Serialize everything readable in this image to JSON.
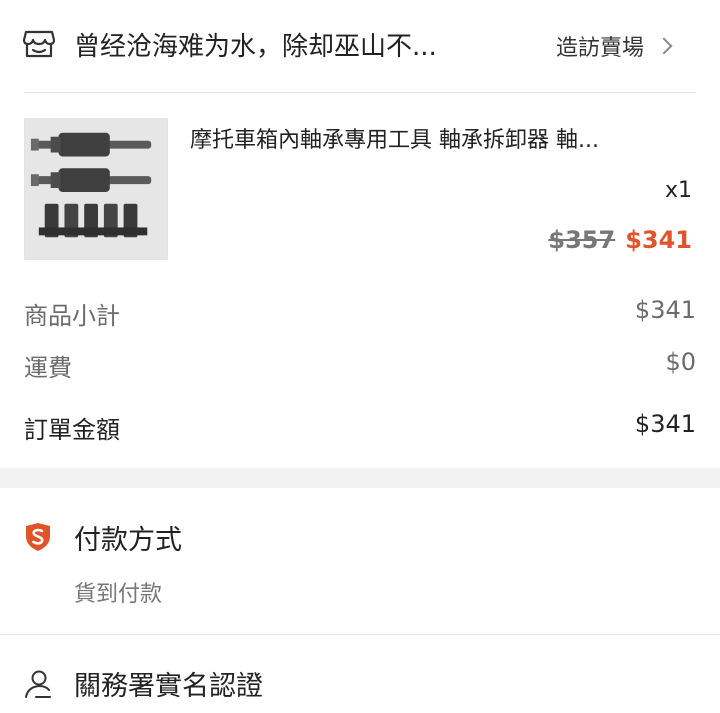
{
  "shop": {
    "name": "曾经沧海难为水，除却巫山不...",
    "visit_label": "造訪賣場",
    "icon": "store-icon"
  },
  "product": {
    "title": "摩托車箱內軸承專用工具 軸承拆卸器 軸...",
    "quantity": "x1",
    "original_price": "$357",
    "sale_price": "$341",
    "image": "bearing-puller-tool-set"
  },
  "summary": {
    "subtotal_label": "商品小計",
    "subtotal_value": "$341",
    "shipping_label": "運費",
    "shipping_value": "$0",
    "total_label": "訂單金額",
    "total_value": "$341"
  },
  "payment": {
    "title": "付款方式",
    "method": "貨到付款",
    "icon": "shield-s-icon"
  },
  "customs": {
    "title": "關務署實名認證",
    "icon": "user-icon"
  },
  "colors": {
    "accent": "#e0542c",
    "muted": "#6b6b6b"
  }
}
